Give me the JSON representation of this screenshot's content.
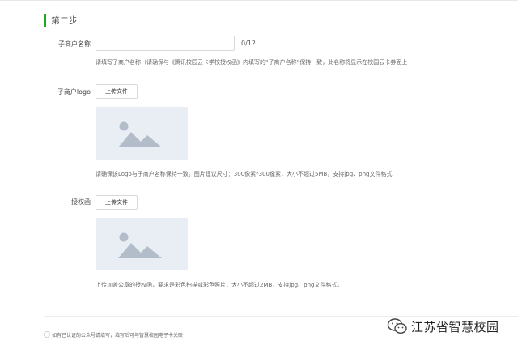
{
  "step": {
    "title": "第二步"
  },
  "form": {
    "name": {
      "label": "子商户名称",
      "value": "",
      "counter": "0/12",
      "hint": "请填写子商户名称（请确保与《腾讯校园云卡学校授权函》内填写的“子商户名称”保持一致，此名称将显示在校园云卡券面上"
    },
    "logo": {
      "label": "子商户logo",
      "upload_label": "上传文件",
      "hint": "请确保该Logo与子商户名称保持一致。图片建议尺寸：300像素*300像素，大小不超过5MB，支持jpg、png文件格式"
    },
    "auth": {
      "label": "授权函",
      "upload_label": "上传文件",
      "hint": "上传加盖公章的授权函，要求是彩色扫描或彩色照片，大小不超过2MB，支持jpg、png文件格式。"
    }
  },
  "footer": {
    "note": "如有已认证的公众号请填写，填写后可与智慧校园电子卡关联"
  },
  "watermark": {
    "text": "江苏省智慧校园",
    "icon": "wechat-icon"
  },
  "colors": {
    "accent": "#1aad19",
    "placeholder_bg": "#e9eef5",
    "placeholder_shape": "#b3bdca"
  }
}
